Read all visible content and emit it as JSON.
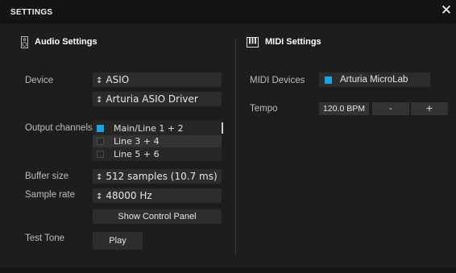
{
  "window": {
    "title": "SETTINGS"
  },
  "audio": {
    "heading": "Audio Settings",
    "device_label": "Device",
    "device_value": "ASIO",
    "driver_value": "Arturia ASIO Driver",
    "output_label": "Output channels",
    "output_channels": [
      {
        "label": "Main/Line 1 + 2",
        "checked": true
      },
      {
        "label": "Line 3 + 4",
        "checked": false
      },
      {
        "label": "Line 5 + 6",
        "checked": false
      }
    ],
    "buffer_label": "Buffer size",
    "buffer_value": "512 samples (10.7 ms)",
    "rate_label": "Sample rate",
    "rate_value": "48000 Hz",
    "control_panel_label": "Show Control Panel",
    "test_tone_label": "Test Tone",
    "play_label": "Play",
    "select_arrow": "↕"
  },
  "midi": {
    "heading": "MIDI Settings",
    "devices_label": "MIDI Devices",
    "device_value": "Arturia MicroLab",
    "tempo_label": "Tempo",
    "tempo_value": "120.0 BPM",
    "tempo_minus": "-",
    "tempo_plus": "+"
  },
  "colors": {
    "accent": "#1aa3e8",
    "background": "#1d1d1d",
    "titlebar": "#141414",
    "field": "#2c2c2c"
  }
}
